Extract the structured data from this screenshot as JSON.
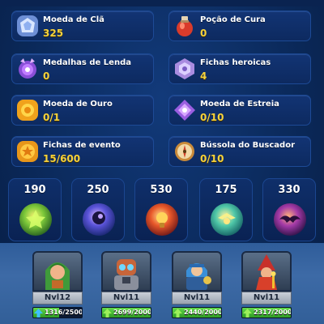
{
  "resources": [
    {
      "name": "Moeda de Clã",
      "value": "325",
      "icon": "clan-coin-icon"
    },
    {
      "name": "Poção de Cura",
      "value": "0",
      "icon": "healing-potion-icon"
    },
    {
      "name": "Medalhas de Lenda",
      "value": "0",
      "icon": "legend-medal-icon"
    },
    {
      "name": "Fichas heroicas",
      "value": "4",
      "icon": "hero-token-icon"
    },
    {
      "name": "Moeda de Ouro",
      "value": "0/1",
      "icon": "gold-coin-icon"
    },
    {
      "name": "Moeda de Estreia",
      "value": "0/10",
      "icon": "debut-coin-icon"
    },
    {
      "name": "Fichas de evento",
      "value": "15/600",
      "icon": "event-token-icon"
    },
    {
      "name": "Bússola do Buscador",
      "value": "0/10",
      "icon": "seeker-compass-icon"
    }
  ],
  "offers": [
    {
      "cost": "190",
      "icon": "green-orb-icon"
    },
    {
      "cost": "250",
      "icon": "blue-purple-orb-icon"
    },
    {
      "cost": "530",
      "icon": "red-orb-icon"
    },
    {
      "cost": "175",
      "icon": "teal-wing-orb-icon"
    },
    {
      "cost": "330",
      "icon": "purple-bat-orb-icon"
    }
  ],
  "heroes": [
    {
      "level": "Nvl12",
      "xp": "1316/2500",
      "progress": 0.53,
      "icon": "hero-green-hood-icon"
    },
    {
      "level": "Nvl11",
      "xp": "2699/2000",
      "progress": 1.0,
      "icon": "hero-robot-icon"
    },
    {
      "level": "Nvl11",
      "xp": "2440/2000",
      "progress": 1.0,
      "icon": "hero-blue-knight-icon"
    },
    {
      "level": "Nvl11",
      "xp": "2317/2000",
      "progress": 1.0,
      "icon": "hero-red-witch-icon"
    }
  ],
  "colors": {
    "value_yellow": "#f6d23c",
    "card_bg": "#123474",
    "xp_green": "#4fc43a"
  }
}
